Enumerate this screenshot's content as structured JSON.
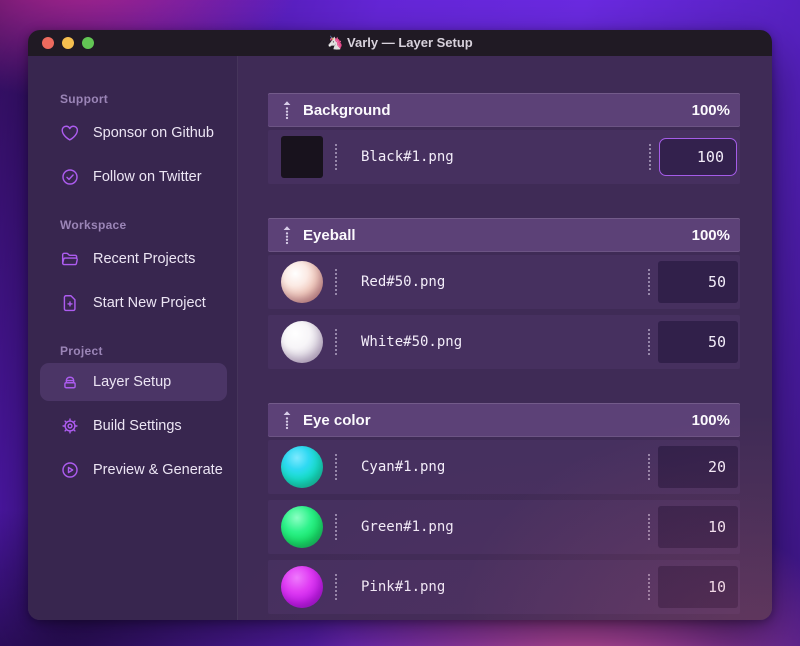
{
  "window": {
    "icon": "🦄",
    "title": "Varly — Layer Setup",
    "traffic_lights": {
      "close": "red",
      "minimize": "yellow",
      "zoom": "green"
    }
  },
  "sidebar": {
    "sections": [
      {
        "label": "Support",
        "items": [
          {
            "label": "Sponsor on Github",
            "icon": "heart-icon"
          },
          {
            "label": "Follow on Twitter",
            "icon": "badge-check-icon"
          }
        ]
      },
      {
        "label": "Workspace",
        "items": [
          {
            "label": "Recent Projects",
            "icon": "folder-open-icon"
          },
          {
            "label": "Start New Project",
            "icon": "document-plus-icon"
          }
        ]
      },
      {
        "label": "Project",
        "items": [
          {
            "label": "Layer Setup",
            "icon": "layers-basket-icon",
            "active": true
          },
          {
            "label": "Build Settings",
            "icon": "gear-icon"
          },
          {
            "label": "Preview & Generate",
            "icon": "play-circle-icon"
          }
        ]
      }
    ]
  },
  "main": {
    "groups": [
      {
        "name": "Background",
        "weight": "100%",
        "layers": [
          {
            "file": "Black#1.png",
            "value": "100",
            "thumb": "black",
            "focused": true
          }
        ]
      },
      {
        "name": "Eyeball",
        "weight": "100%",
        "layers": [
          {
            "file": "Red#50.png",
            "value": "50",
            "thumb": "red"
          },
          {
            "file": "White#50.png",
            "value": "50",
            "thumb": "white"
          }
        ]
      },
      {
        "name": "Eye color",
        "weight": "100%",
        "layers": [
          {
            "file": "Cyan#1.png",
            "value": "20",
            "thumb": "cyan"
          },
          {
            "file": "Green#1.png",
            "value": "10",
            "thumb": "green"
          },
          {
            "file": "Pink#1.png",
            "value": "10",
            "thumb": "pink"
          }
        ]
      }
    ]
  },
  "colors": {
    "accent_icon": "#ad5cf0",
    "focus_border": "#a55ce8",
    "titlebar_bg": "#201a24",
    "sidebar_bg": "#38264f",
    "main_bg": "#3f2b56",
    "group_header_bg": "#5c4177",
    "row_bg": "#46305f",
    "active_item_bg": "#4b3566",
    "traffic_red": "#ed6a5e",
    "traffic_yellow": "#f5bf4f",
    "traffic_green": "#62c554"
  }
}
